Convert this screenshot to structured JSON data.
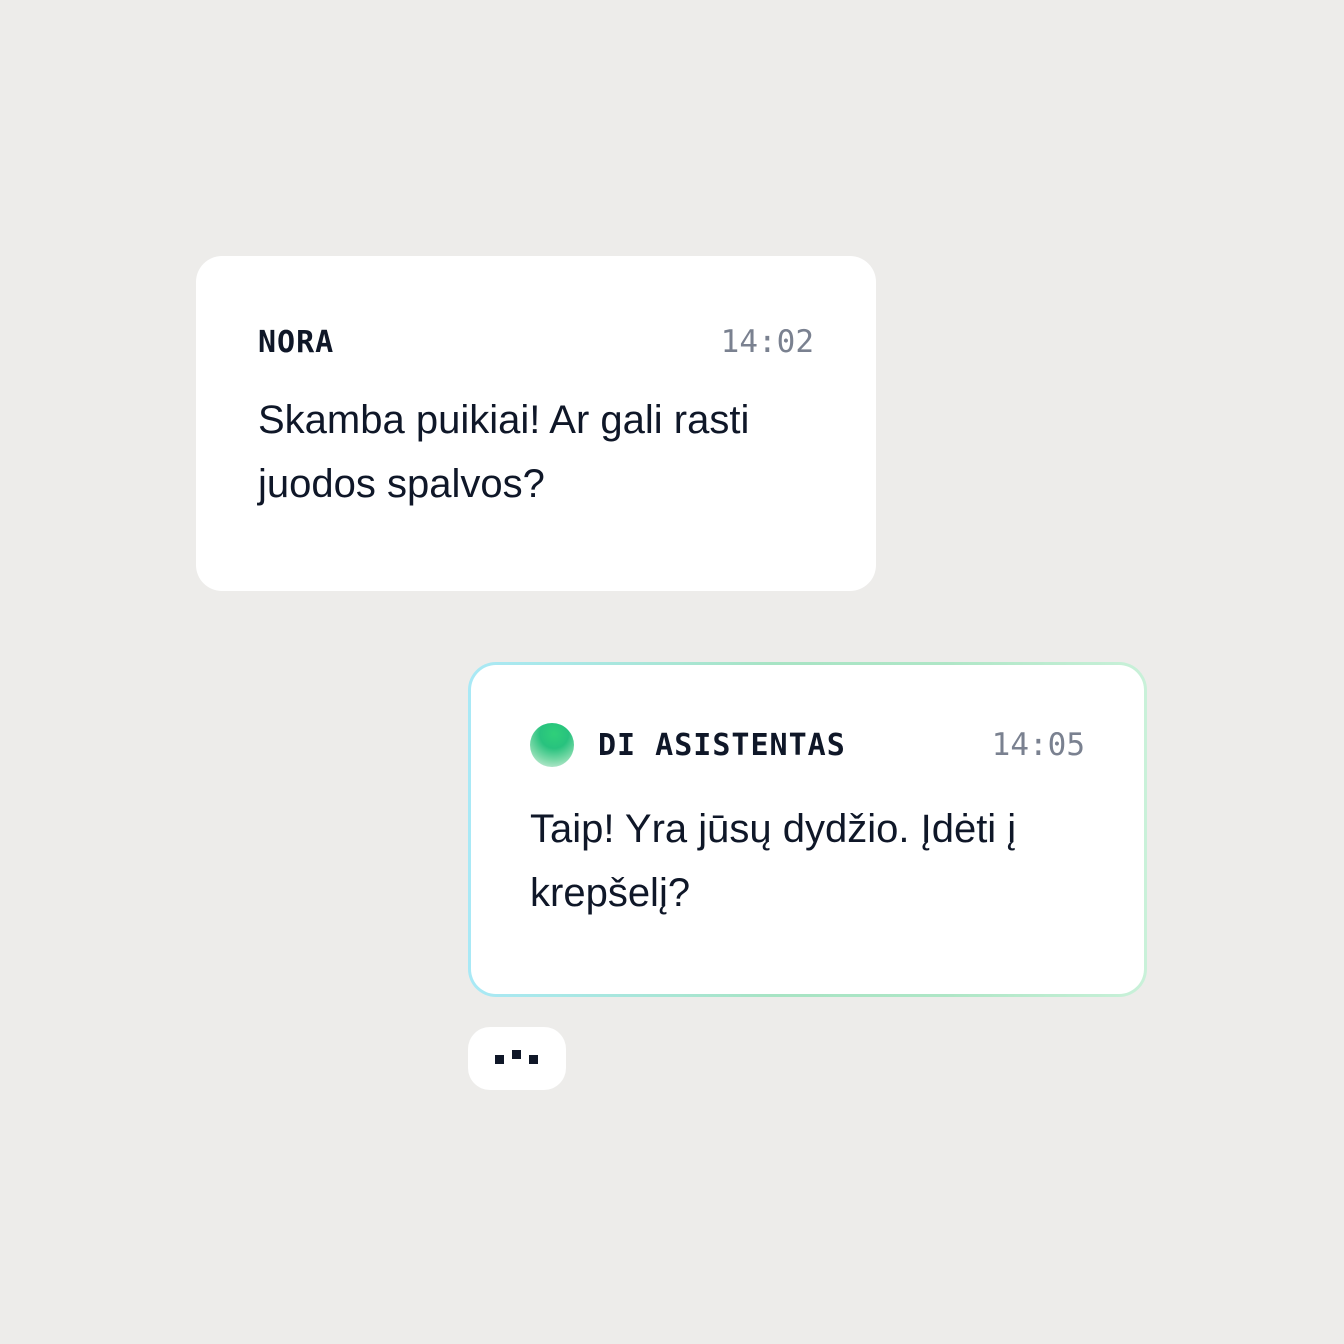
{
  "messages": [
    {
      "sender": "NORA",
      "time": "14:02",
      "text": "Skamba puikiai! Ar gali rasti juodos spalvos?"
    },
    {
      "sender": "DI ASISTENTAS",
      "time": "14:05",
      "text": "Taip! Yra jūsų dydžio. Įdėti į krepšelį?",
      "avatar_icon": "assistant-orb-icon"
    }
  ],
  "typing_indicator": {
    "icon": "typing-dots-icon"
  },
  "colors": {
    "background": "#edecea",
    "card": "#ffffff",
    "text": "#0f1728",
    "timestamp": "#7a8190",
    "ai_border_start": "#a9e9f6",
    "ai_border_end": "#c9f1d9",
    "orb": "#28c27e"
  }
}
